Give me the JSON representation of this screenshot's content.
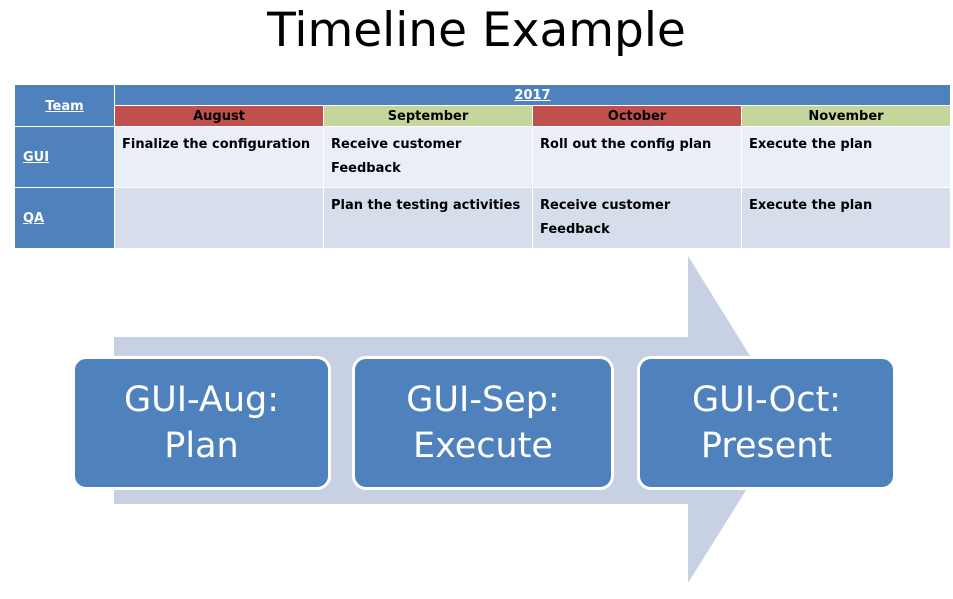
{
  "title": "Timeline Example",
  "table": {
    "team_header": "Team",
    "year_header": "2017",
    "months": [
      "August",
      "September",
      "October",
      "November"
    ],
    "month_colors": [
      "#C0504D",
      "#C3D69B",
      "#C0504D",
      "#C3D69B"
    ],
    "rows": [
      {
        "team": "GUI",
        "row_bg": "#EAEEF6",
        "cells": [
          "Finalize the configuration",
          "Receive customer\n Feedback",
          "Roll out the config plan",
          "Execute the plan"
        ]
      },
      {
        "team": "QA",
        "row_bg": "#D6DDEB",
        "cells": [
          "",
          "Plan the testing activities",
          "Receive customer\nFeedback",
          "Execute the plan"
        ]
      }
    ]
  },
  "process": {
    "arrow_color": "#C8D1E3",
    "box_color": "#4F81BD",
    "box_text_color": "#FFFFFF",
    "boxes": [
      {
        "line1": "GUI-Aug:",
        "line2": "Plan"
      },
      {
        "line1": "GUI-Sep:",
        "line2": "Execute"
      },
      {
        "line1": "GUI-Oct:",
        "line2": "Present"
      }
    ]
  },
  "colors": {
    "header_blue": "#4F81BD",
    "accent_red": "#C0504D",
    "accent_green": "#C3D69B",
    "arrow_gray_blue": "#C8D1E3",
    "background": "#FFFFFF"
  }
}
